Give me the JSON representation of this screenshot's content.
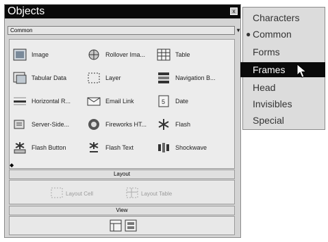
{
  "panel": {
    "title": "Objects",
    "close_glyph": "x",
    "category_selected": "Common",
    "objects": [
      {
        "label": "Image",
        "icon": "image-icon"
      },
      {
        "label": "Rollover Ima...",
        "icon": "rollover-image-icon"
      },
      {
        "label": "Table",
        "icon": "table-icon"
      },
      {
        "label": "Tabular Data",
        "icon": "tabular-data-icon"
      },
      {
        "label": "Layer",
        "icon": "layer-icon"
      },
      {
        "label": "Navigation B...",
        "icon": "navigation-bar-icon"
      },
      {
        "label": "Horizontal R...",
        "icon": "horizontal-rule-icon"
      },
      {
        "label": "Email Link",
        "icon": "email-link-icon"
      },
      {
        "label": "Date",
        "icon": "date-icon"
      },
      {
        "label": "Server-Side...",
        "icon": "server-side-include-icon"
      },
      {
        "label": "Fireworks HT...",
        "icon": "fireworks-html-icon"
      },
      {
        "label": "Flash",
        "icon": "flash-icon"
      },
      {
        "label": "Flash Button",
        "icon": "flash-button-icon"
      },
      {
        "label": "Flash Text",
        "icon": "flash-text-icon"
      },
      {
        "label": "Shockwave",
        "icon": "shockwave-icon"
      }
    ],
    "layout": {
      "header": "Layout",
      "draw_cell": "Layout Cell",
      "draw_table": "Layout Table"
    },
    "view": {
      "header": "View",
      "modes": [
        "standard-view-icon",
        "layout-view-icon"
      ]
    }
  },
  "menu": {
    "items": [
      {
        "label": "Characters",
        "checked": false,
        "highlighted": false
      },
      {
        "label": "Common",
        "checked": true,
        "highlighted": false
      },
      {
        "label": "Forms",
        "checked": false,
        "highlighted": false
      },
      {
        "label": "Frames",
        "checked": false,
        "highlighted": true
      },
      {
        "label": "Head",
        "checked": false,
        "highlighted": false
      },
      {
        "label": "Invisibles",
        "checked": false,
        "highlighted": false
      },
      {
        "label": "Special",
        "checked": false,
        "highlighted": false
      }
    ]
  }
}
